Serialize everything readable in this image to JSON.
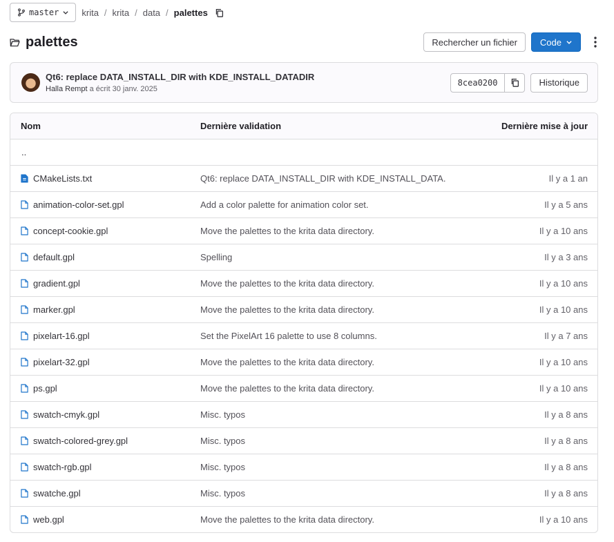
{
  "branch": {
    "name": "master"
  },
  "breadcrumbs": [
    "krita",
    "krita",
    "data",
    "palettes"
  ],
  "breadcrumb_separator": "/",
  "folder_title": "palettes",
  "actions": {
    "find_file": "Rechercher un fichier",
    "code": "Code"
  },
  "last_commit": {
    "title": "Qt6: replace DATA_INSTALL_DIR with KDE_INSTALL_DATADIR",
    "author": "Halla Rempt",
    "meta_rest": " a écrit 30 janv. 2025",
    "sha": "8cea0200",
    "history_label": "Historique"
  },
  "table": {
    "headers": {
      "name": "Nom",
      "commit": "Dernière validation",
      "date": "Dernière mise à jour"
    },
    "parent_dir": "..",
    "rows": [
      {
        "name": "CMakeLists.txt",
        "icon": "file-text-icon",
        "commit": "Qt6: replace DATA_INSTALL_DIR with KDE_INSTALL_DATA...",
        "date": "Il y a 1 an"
      },
      {
        "name": "animation-color-set.gpl",
        "icon": "file-icon",
        "commit": "Add a color palette for animation color set.",
        "date": "Il y a 5 ans"
      },
      {
        "name": "concept-cookie.gpl",
        "icon": "file-icon",
        "commit": "Move the palettes to the krita data directory.",
        "date": "Il y a 10 ans"
      },
      {
        "name": "default.gpl",
        "icon": "file-icon",
        "commit": "Spelling",
        "date": "Il y a 3 ans"
      },
      {
        "name": "gradient.gpl",
        "icon": "file-icon",
        "commit": "Move the palettes to the krita data directory.",
        "date": "Il y a 10 ans"
      },
      {
        "name": "marker.gpl",
        "icon": "file-icon",
        "commit": "Move the palettes to the krita data directory.",
        "date": "Il y a 10 ans"
      },
      {
        "name": "pixelart-16.gpl",
        "icon": "file-icon",
        "commit": "Set the PixelArt 16 palette to use 8 columns.",
        "date": "Il y a 7 ans"
      },
      {
        "name": "pixelart-32.gpl",
        "icon": "file-icon",
        "commit": "Move the palettes to the krita data directory.",
        "date": "Il y a 10 ans"
      },
      {
        "name": "ps.gpl",
        "icon": "file-icon",
        "commit": "Move the palettes to the krita data directory.",
        "date": "Il y a 10 ans"
      },
      {
        "name": "swatch-cmyk.gpl",
        "icon": "file-icon",
        "commit": "Misc. typos",
        "date": "Il y a 8 ans"
      },
      {
        "name": "swatch-colored-grey.gpl",
        "icon": "file-icon",
        "commit": "Misc. typos",
        "date": "Il y a 8 ans"
      },
      {
        "name": "swatch-rgb.gpl",
        "icon": "file-icon",
        "commit": "Misc. typos",
        "date": "Il y a 8 ans"
      },
      {
        "name": "swatche.gpl",
        "icon": "file-icon",
        "commit": "Misc. typos",
        "date": "Il y a 8 ans"
      },
      {
        "name": "web.gpl",
        "icon": "file-icon",
        "commit": "Move the palettes to the krita data directory.",
        "date": "Il y a 10 ans"
      }
    ]
  },
  "colors": {
    "primary": "#1f75cb",
    "file_icon": "#1f75cb",
    "border": "#dcdcde",
    "text": "#333238"
  }
}
